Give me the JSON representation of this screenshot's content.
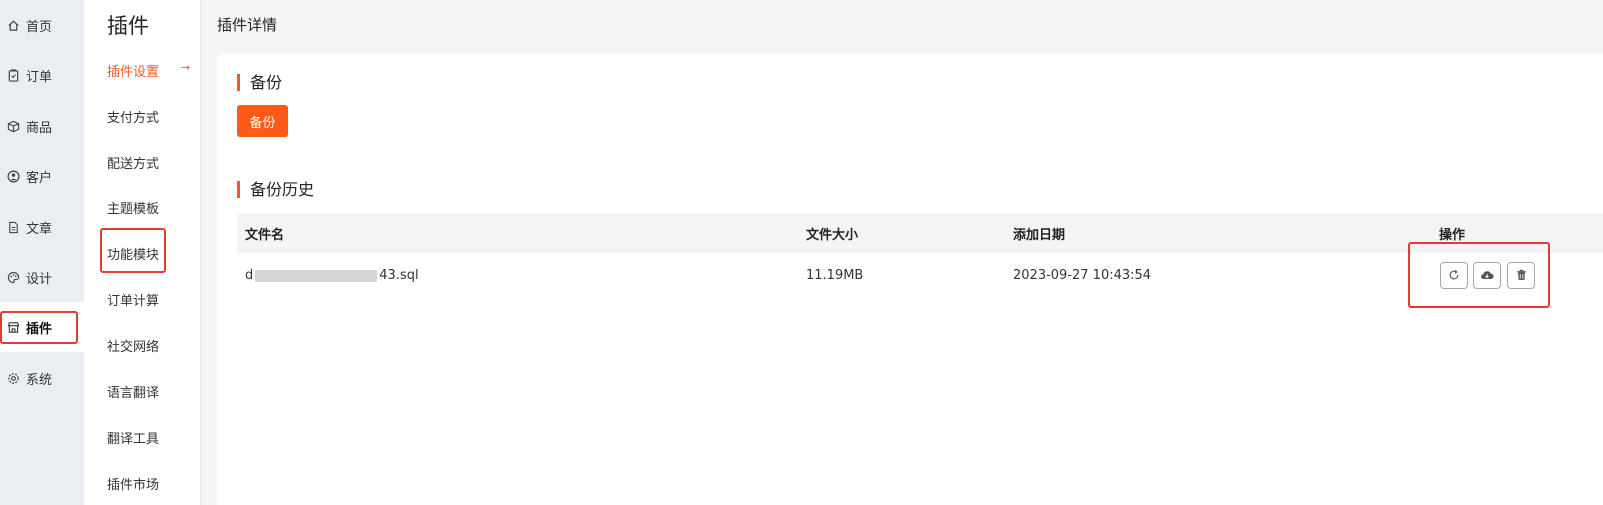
{
  "sidebar": {
    "items": [
      {
        "label": "首页",
        "icon": "home-icon"
      },
      {
        "label": "订单",
        "icon": "clipboard-icon"
      },
      {
        "label": "商品",
        "icon": "box-icon"
      },
      {
        "label": "客户",
        "icon": "user-circle-icon"
      },
      {
        "label": "文章",
        "icon": "document-icon"
      },
      {
        "label": "设计",
        "icon": "palette-icon"
      },
      {
        "label": "插件",
        "icon": "store-icon",
        "active": true
      },
      {
        "label": "系统",
        "icon": "gear-icon"
      }
    ]
  },
  "submenu": {
    "title": "插件",
    "items": [
      {
        "label": "插件设置",
        "active": true
      },
      {
        "label": "支付方式"
      },
      {
        "label": "配送方式"
      },
      {
        "label": "主题模板"
      },
      {
        "label": "功能模块"
      },
      {
        "label": "订单计算"
      },
      {
        "label": "社交网络"
      },
      {
        "label": "语言翻译"
      },
      {
        "label": "翻译工具"
      },
      {
        "label": "插件市场"
      }
    ],
    "active_arrow": "→"
  },
  "main": {
    "page_title": "插件详情",
    "backup_section": {
      "title": "备份",
      "button_label": "备份"
    },
    "history_section": {
      "title": "备份历史",
      "columns": [
        "文件名",
        "文件大小",
        "添加日期",
        "操作"
      ],
      "rows": [
        {
          "filename_prefix": "d",
          "filename_suffix": "43.sql",
          "size": "11.19MB",
          "date": "2023-09-27 10:43:54",
          "actions": [
            "refresh-icon",
            "cloud-download-icon",
            "trash-icon"
          ]
        }
      ]
    }
  },
  "colors": {
    "accent": "#fc5a16",
    "highlight": "#e53935"
  }
}
